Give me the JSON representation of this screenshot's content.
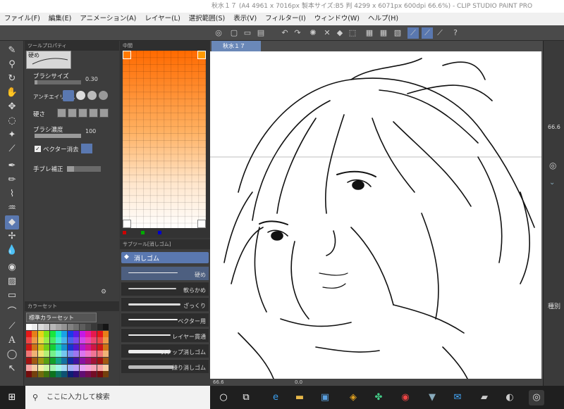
{
  "window": {
    "title": "秋水１７ (A4 4961 x 7016px 製本サイズ:B5 判 4299 x 6071px 600dpi 66.6%) - CLIP STUDIO PAINT PRO"
  },
  "menu": [
    "ファイル(F)",
    "編集(E)",
    "アニメーション(A)",
    "レイヤー(L)",
    "選択範囲(S)",
    "表示(V)",
    "フィルター(I)",
    "ウィンドウ(W)",
    "ヘルプ(H)"
  ],
  "tool_property": {
    "header": "ツールプロパティ",
    "preset": "硬め",
    "brush_size": {
      "label": "ブラシサイズ",
      "value": "0.30"
    },
    "antialias": {
      "label": "アンチエイリアス"
    },
    "hardness": {
      "label": "硬さ"
    },
    "density": {
      "label": "ブラシ濃度",
      "value": "100"
    },
    "vector_erase": {
      "label": "ベクター消去"
    },
    "stabilization": {
      "label": "手ブレ補正"
    }
  },
  "color_set": {
    "header": "カラーセット",
    "selected": "標準カラーセット"
  },
  "color_panel": {
    "header": "中間"
  },
  "sub_tool": {
    "header": "サブツール[消しゴム]",
    "group": "消しゴム",
    "items": [
      {
        "label": "硬め",
        "selected": true
      },
      {
        "label": "軟らかめ"
      },
      {
        "label": "ざっくり"
      },
      {
        "label": "ベクター用"
      },
      {
        "label": "レイヤー貫通"
      },
      {
        "label": "スナップ消しゴム"
      },
      {
        "label": "練り消しゴム"
      }
    ]
  },
  "canvas": {
    "tab": "秋水１７",
    "zoom": "66.6",
    "angle": "0.0"
  },
  "right": {
    "label": "種別",
    "zoom": "66.6"
  },
  "taskbar": {
    "search_placeholder": "ここに入力して検索"
  },
  "colors": {
    "accent": "#5a78b0",
    "panel": "#3d3d3d"
  }
}
